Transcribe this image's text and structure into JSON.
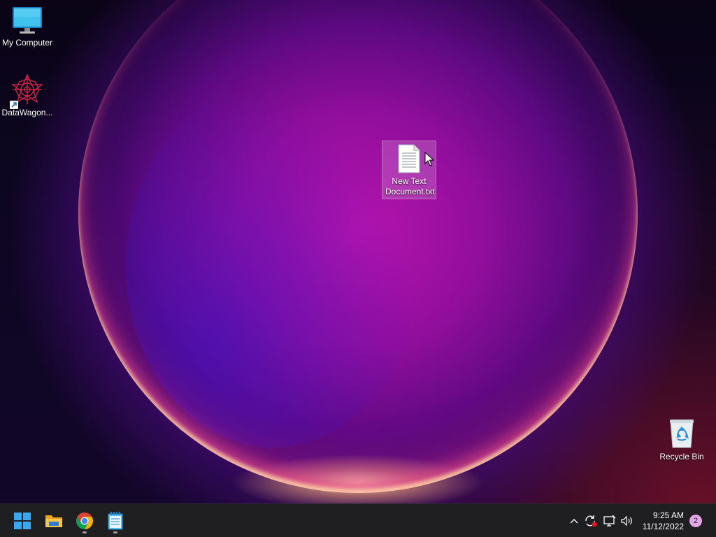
{
  "desktop": {
    "icons": {
      "my_computer": {
        "label": "My Computer",
        "icon": "monitor-icon"
      },
      "datawagon": {
        "label": "DataWagon...",
        "icon": "datawagon-icon"
      },
      "new_text_document": {
        "label": "New Text Document.txt",
        "icon": "text-file-icon"
      },
      "recycle_bin": {
        "label": "Recycle Bin",
        "icon": "recycle-bin-icon"
      }
    }
  },
  "taskbar": {
    "apps": [
      {
        "name": "Start",
        "icon": "windows-start-icon"
      },
      {
        "name": "File Explorer",
        "icon": "folder-icon"
      },
      {
        "name": "Google Chrome",
        "icon": "chrome-icon"
      },
      {
        "name": "Notepad",
        "icon": "notepad-icon"
      }
    ],
    "tray": {
      "time": "9:25 AM",
      "date": "11/12/2022",
      "notification_count": "2"
    }
  },
  "colors": {
    "taskbar_bg": "#1f1f22",
    "windows_blue": "#38a9f0",
    "folder_yellow": "#f5c64a",
    "notif_badge": "#e3a6e6"
  }
}
